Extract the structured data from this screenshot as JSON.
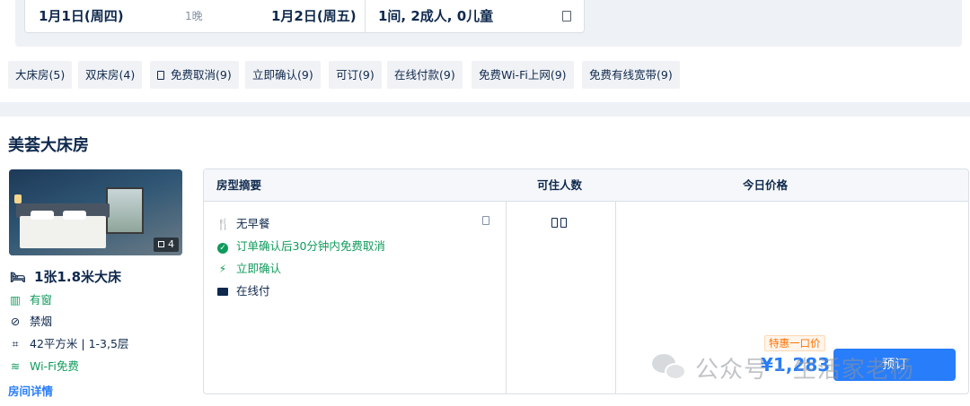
{
  "search": {
    "checkin": "1月1日(周四)",
    "nights": "1晚",
    "checkout": "1月2日(周五)",
    "guests": "1间, 2成人, 0儿童"
  },
  "filters": [
    {
      "label": "大床房(5)"
    },
    {
      "label": "双床房(4)"
    },
    {
      "label": "免费取消(9)"
    },
    {
      "label": "立即确认(9)"
    },
    {
      "label": "可订(9)"
    },
    {
      "label": "在线付款(9)"
    },
    {
      "label": "免费Wi-Fi上网(9)"
    },
    {
      "label": "免费有线宽带(9)"
    }
  ],
  "room": {
    "title": "美荟大床房",
    "photo_count": "4",
    "bed": "1张1.8米大床",
    "window": "有窗",
    "smoking": "禁烟",
    "area_floor": "42平方米 | 1-3,5层",
    "wifi": "Wi-Fi免费",
    "detail_link": "房间详情"
  },
  "table": {
    "headers": {
      "summary": "房型摘要",
      "occupancy": "可住人数",
      "price": "今日价格"
    },
    "perks": {
      "meal": "无早餐",
      "cancel": "订单确认后30分钟内免费取消",
      "confirm": "立即确认",
      "payment": "在线付"
    },
    "promo_tag": "特惠一口价",
    "price": "¥1,283",
    "book_label": "预订"
  },
  "watermark": {
    "text": "公众号 · 生活家老杨"
  },
  "icons": {
    "meal": "no-breakfast-icon",
    "cancel": "check-circle-icon",
    "confirm": "lightning-icon",
    "payment": "card-icon",
    "bed": "bed-icon",
    "window": "window-icon",
    "smoking": "no-smoking-icon",
    "area": "area-icon",
    "wifi": "wifi-icon"
  },
  "colors": {
    "accent": "#287dfa",
    "green": "#0e9a5b",
    "promo": "#ff6f00",
    "text": "#0f294d"
  }
}
